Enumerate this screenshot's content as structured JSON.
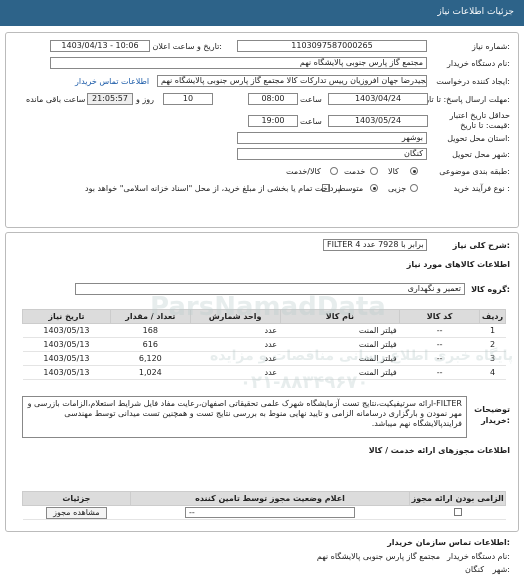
{
  "header": {
    "title": "جزئیات اطلاعات نیاز"
  },
  "form": {
    "need_number_label": "شماره نیاز:",
    "need_number": "1103097587000265",
    "announce_label": "تاریخ و ساعت اعلان عمومی:",
    "announce_value": "1403/04/13 - 10:06",
    "buyer_label": "نام دستگاه خریدار:",
    "buyer_value": "مجتمع گاز پارس جنوبی  پالایشگاه نهم",
    "creator_label": "ایجاد کننده درخواست:",
    "creator_value": "مجیدرضا جهان افروزیان رییس تدارکات کالا مجتمع گاز پارس جنوبی  پالایشگاه نهم",
    "contact_link": "اطلاعات تماس خریدار",
    "deadline_label": "مهلت ارسال پاسخ: تا تاریخ:",
    "deadline_date": "1403/04/24",
    "time_label": "ساعت",
    "deadline_time": "08:00",
    "days_value": "10",
    "days_label": "روز و",
    "remaining_time": "21:05:57",
    "remaining_label": "ساعت باقی مانده",
    "validity_label_1": "حداقل تاریخ اعتبار",
    "validity_label_2": "قیمت: تا تاریخ:",
    "validity_date": "1403/05/24",
    "validity_time_label": "ساعت",
    "validity_time": "19:00",
    "province_label": "استان محل تحویل:",
    "province_value": "بوشهر",
    "city_label": "شهر محل تحویل:",
    "city_value": "کنگان",
    "category_label": "طبقه بندی موضوعی:",
    "category_options": [
      "کالا",
      "خدمت",
      "کالا/خدمت"
    ],
    "category_selected": "کالا",
    "process_label": "نوع فرآیند خرید :",
    "process_options": [
      "جزیی",
      "متوسط"
    ],
    "process_selected": "متوسط",
    "payment_note": "پرداخت تمام یا بخشی از مبلغ خرید، از محل \"اسناد خزانه اسلامی\" خواهد بود."
  },
  "description": {
    "label": "شرح کلی نیاز:",
    "value": "FILTER 4 ردیف برابر با 7928 عدد"
  },
  "goods": {
    "section_title": "اطلاعات کالاهای مورد نیاز",
    "group_label": "گروه کالا:",
    "group_value": "تعمیر و نگهداری",
    "columns": [
      "ردیف",
      "کد کالا",
      "نام کالا",
      "واحد شمارش",
      "تعداد / مقدار",
      "تاریخ نیاز"
    ],
    "rows": [
      {
        "row": "1",
        "code": "--",
        "name": "فیلتر المنت",
        "unit": "عدد",
        "qty": "168",
        "date": "1403/05/13"
      },
      {
        "row": "2",
        "code": "--",
        "name": "فیلتر المنت",
        "unit": "عدد",
        "qty": "616",
        "date": "1403/05/13"
      },
      {
        "row": "3",
        "code": "--",
        "name": "فیلتر المنت",
        "unit": "عدد",
        "qty": "6,120",
        "date": "1403/05/13"
      },
      {
        "row": "4",
        "code": "--",
        "name": "فیلتر المنت",
        "unit": "عدد",
        "qty": "1,024",
        "date": "1403/05/13"
      }
    ]
  },
  "buyer_notes": {
    "label_1": "توضیحات",
    "label_2": "خریدار:",
    "text": "FILTER-ارائه سرتیفیکیت،نتایج تست آزمایشگاه شهرک علمی تحقیقاتی اصفهان،رعایت مفاد فایل شرایط استعلام،الزامات بازرسی و مهر نمودن و بارگزاری درسامانه الزامی و تایید نهایی منوط به بررسی نتایج تست و همچنین تست میدانی توسط مهندسی فرایندپالایشگاه نهم میباشد."
  },
  "licenses": {
    "section_title": "اطلاعات مجوزهای ارائه خدمت / کالا",
    "columns": [
      "الزامی بودن ارائه مجوز",
      "اعلام وضعیت مجوز توسط تامین کننده",
      "جزئیات"
    ],
    "row": {
      "status": "--",
      "details_button": "مشاهده مجوز"
    }
  },
  "buyer_org": {
    "section_title": "اطلاعات تماس سازمان خریدار:",
    "name_label": "نام دستگاه خریدار:",
    "name_value": "مجتمع گاز پارس جنوبی  پالایشگاه نهم",
    "city_label": "شهر:",
    "city_value": "کنگان"
  },
  "watermark": {
    "brand": "ParsNamadData",
    "line1": "پایگاه خبری اطلاع رسانی مناقصات و مزایده",
    "phone": "۰۲۱-۸۸۳۴۹۶۷۰"
  },
  "colors": {
    "header_bg": "#2d6389",
    "link": "#1a5aa8",
    "table_head": "#dcdcdc"
  }
}
